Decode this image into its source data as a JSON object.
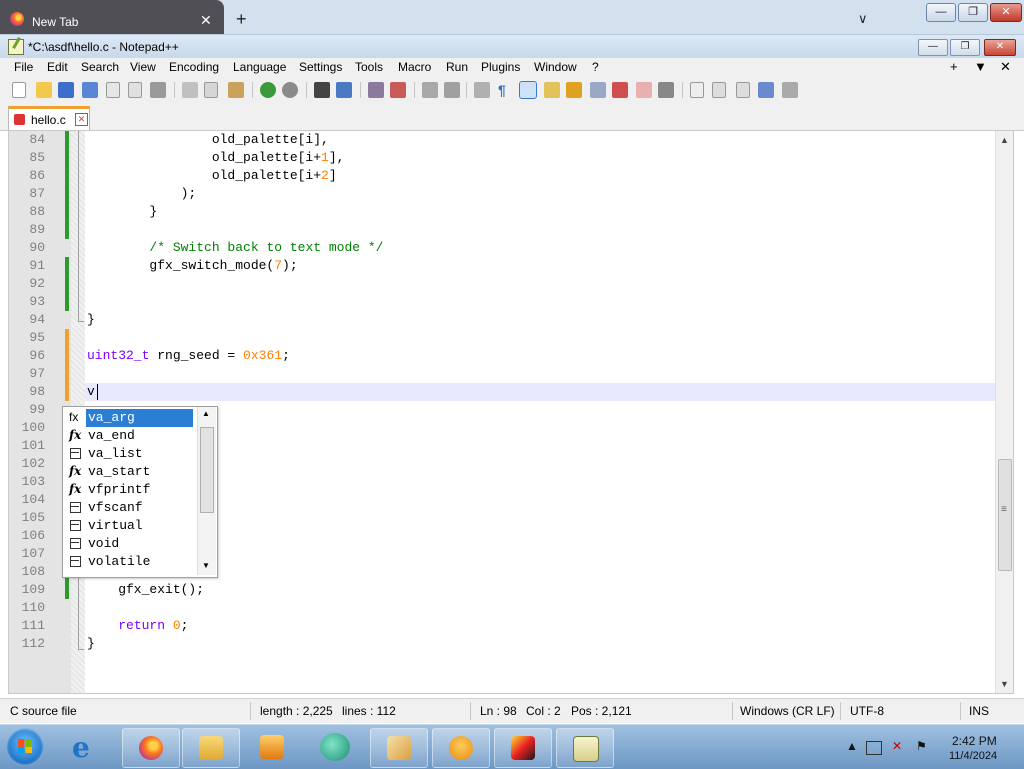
{
  "browser": {
    "tab_title": "New Tab",
    "tab_close": "✕",
    "new_tab": "+",
    "tabs_menu": "∨"
  },
  "window": {
    "title": "*C:\\asdf\\hello.c - Notepad++",
    "min": "—",
    "max": "❐",
    "close": "✕"
  },
  "menu": {
    "items": [
      "File",
      "Edit",
      "Search",
      "View",
      "Encoding",
      "Language",
      "Settings",
      "Tools",
      "Macro",
      "Run",
      "Plugins",
      "Window",
      "?"
    ],
    "right": [
      "+",
      "▼",
      "✕"
    ]
  },
  "toolbar_icons": [
    "new-file-icon",
    "open-file-icon",
    "save-icon",
    "save-all-icon",
    "close-icon",
    "close-all-icon",
    "print-icon",
    "cut-icon",
    "copy-icon",
    "paste-icon",
    "undo-icon",
    "redo-icon",
    "find-icon",
    "replace-icon",
    "zoom-in-icon",
    "zoom-out-icon",
    "sync-v-icon",
    "sync-h-icon",
    "word-wrap-icon",
    "all-chars-icon",
    "indent-guide-icon",
    "lang-icon",
    "doc-map-icon",
    "function-list-icon",
    "folder-icon",
    "monitor-icon",
    "record-icon",
    "stop-icon",
    "play-icon",
    "play-multi-icon",
    "save-macro-icon"
  ],
  "file_tab": {
    "label": "hello.c",
    "close": "✕"
  },
  "editor": {
    "lines": [
      {
        "n": "84",
        "html": "                old_palette[i],"
      },
      {
        "n": "85",
        "html": "                old_palette[i+<span class=\"num\">1</span>],"
      },
      {
        "n": "86",
        "html": "                old_palette[i+<span class=\"num\">2</span>]"
      },
      {
        "n": "87",
        "html": "            );"
      },
      {
        "n": "88",
        "html": "        }"
      },
      {
        "n": "89",
        "html": ""
      },
      {
        "n": "90",
        "html": "        <span class=\"cm\">/* Switch back to text mode */</span>"
      },
      {
        "n": "91",
        "html": "        gfx_switch_mode(<span class=\"num\">7</span>);"
      },
      {
        "n": "92",
        "html": ""
      },
      {
        "n": "93",
        "html": ""
      },
      {
        "n": "94",
        "html": "}"
      },
      {
        "n": "95",
        "html": ""
      },
      {
        "n": "96",
        "html": "<span class=\"ty\">uint32_t</span> rng_seed = <span class=\"num\">0x361</span>;"
      },
      {
        "n": "97",
        "html": ""
      },
      {
        "n": "98",
        "html": "v"
      },
      {
        "n": "99",
        "html": ""
      },
      {
        "n": "100",
        "html": ""
      },
      {
        "n": "101",
        "html": ""
      },
      {
        "n": "102",
        "html": ""
      },
      {
        "n": "103",
        "html": ""
      },
      {
        "n": "104",
        "html": ""
      },
      {
        "n": "105",
        "html": ""
      },
      {
        "n": "106",
        "html": ""
      },
      {
        "n": "107",
        "html": ""
      },
      {
        "n": "108",
        "html": ""
      },
      {
        "n": "109",
        "html": "    gfx_exit();"
      },
      {
        "n": "110",
        "html": ""
      },
      {
        "n": "111",
        "html": "    <span class=\"kw\">return</span> <span class=\"num\">0</span>;"
      },
      {
        "n": "112",
        "html": "}"
      }
    ]
  },
  "autocomplete": {
    "items": [
      {
        "label": "va_arg",
        "kind": "function"
      },
      {
        "label": "va_end",
        "kind": "function"
      },
      {
        "label": "va_list",
        "kind": "keyword"
      },
      {
        "label": "va_start",
        "kind": "function"
      },
      {
        "label": "vfprintf",
        "kind": "function"
      },
      {
        "label": "vfscanf",
        "kind": "keyword"
      },
      {
        "label": "virtual",
        "kind": "keyword"
      },
      {
        "label": "void",
        "kind": "keyword"
      },
      {
        "label": "volatile",
        "kind": "keyword"
      }
    ],
    "selected": "va_arg",
    "function_glyph": "fx"
  },
  "status": {
    "file_type": "C source file",
    "length": "length : 2,225",
    "lines": "lines : 112",
    "ln": "Ln : 98",
    "col": "Col : 2",
    "pos": "Pos : 2,121",
    "eol": "Windows (CR LF)",
    "encoding": "UTF-8",
    "mode": "INS"
  },
  "taskbar": {
    "apps": [
      "internet-explorer-icon",
      "firefox-icon",
      "file-explorer-icon",
      "media-player-icon",
      "app-icon",
      "paint-icon",
      "scratch-icon",
      "winamp-icon",
      "notepad-plus-plus-icon"
    ],
    "time": "2:42 PM",
    "date": "11/4/2024"
  },
  "colors": {
    "keyword": "#8000ff",
    "number": "#ff8000",
    "comment": "#008000",
    "selection": "#2a7fd4",
    "caret_line": "#e8e8ff"
  }
}
